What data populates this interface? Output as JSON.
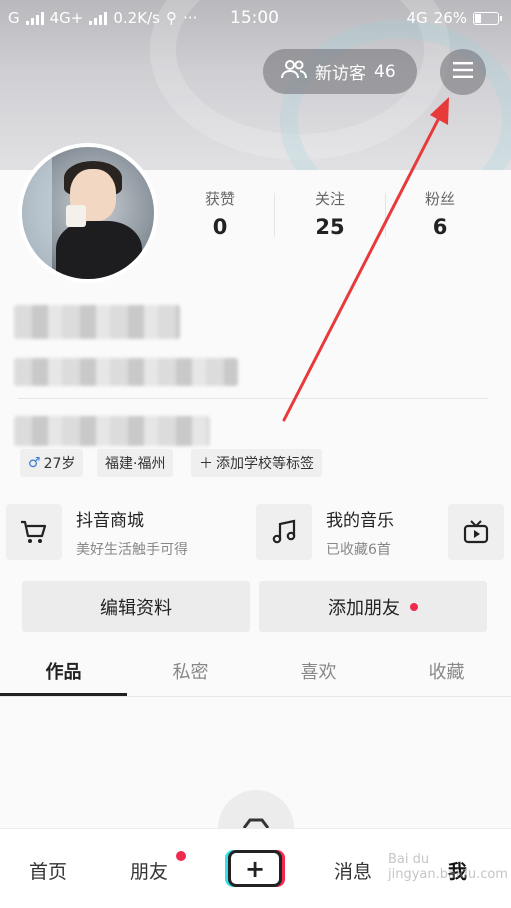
{
  "status_bar": {
    "left_text": "G",
    "network": "4G+",
    "speed": "0.2K/s",
    "dots": "···",
    "time": "15:00",
    "right_network": "4G",
    "battery": "26%"
  },
  "header": {
    "visitor_label": "新访客",
    "visitor_count": "46"
  },
  "stats": [
    {
      "label": "获赞",
      "value": "0"
    },
    {
      "label": "关注",
      "value": "25"
    },
    {
      "label": "粉丝",
      "value": "6"
    }
  ],
  "tags": {
    "age": "27岁",
    "location": "福建·福州",
    "add_school": "添加学校等标签"
  },
  "cards": [
    {
      "title": "抖音商城",
      "subtitle": "美好生活触手可得"
    },
    {
      "title": "我的音乐",
      "subtitle": "已收藏6首"
    }
  ],
  "buttons": {
    "edit_profile": "编辑资料",
    "add_friend": "添加朋友"
  },
  "tabs": [
    "作品",
    "私密",
    "喜欢",
    "收藏"
  ],
  "bottom_nav": {
    "home": "首页",
    "friends": "朋友",
    "plus": "+",
    "messages": "消息",
    "me": "我"
  },
  "watermark": "Bai du jingyan.baidu.com",
  "colors": {
    "accent_red": "#f0294f",
    "accent_cyan": "#37e0e6",
    "annotation_arrow": "#e83a3a"
  }
}
